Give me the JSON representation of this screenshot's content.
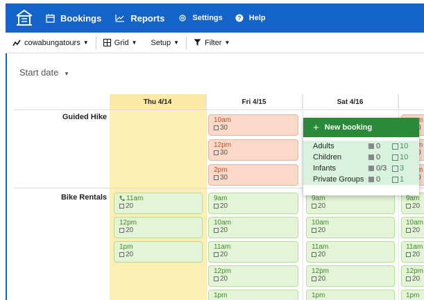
{
  "nav": {
    "bookings": "Bookings",
    "reports": "Reports",
    "settings": "Settings",
    "help": "Help"
  },
  "toolbar": {
    "account": "cowabungatours",
    "grid": "Grid",
    "setup": "Setup",
    "filter": "Filter"
  },
  "start_date": "Start date",
  "columns": [
    {
      "label": "Thu 4/14"
    },
    {
      "label": "Fri 4/15"
    },
    {
      "label": "Sat 4/16"
    }
  ],
  "rows": {
    "guided_hike": "Guided Hike",
    "bike_rentals": "Bike Rentals"
  },
  "slots": {
    "hike_fri": [
      {
        "time": "10am",
        "cap": "30"
      },
      {
        "time": "12pm",
        "cap": "30"
      },
      {
        "time": "2pm",
        "cap": "30"
      }
    ],
    "hike_sun": [
      {
        "time": "m",
        "cap": "0"
      },
      {
        "time": "m",
        "cap": "0"
      },
      {
        "time": "m",
        "cap": "0"
      }
    ],
    "bike_thu": [
      {
        "time": "11am",
        "cap": "20"
      },
      {
        "time": "12pm",
        "cap": "20"
      },
      {
        "time": "1pm",
        "cap": "20"
      }
    ],
    "bike_fri": [
      {
        "time": "9am",
        "cap": "20"
      },
      {
        "time": "10am",
        "cap": "20"
      },
      {
        "time": "11am",
        "cap": "20"
      },
      {
        "time": "12pm",
        "cap": "20"
      },
      {
        "time": "1pm",
        "cap": ""
      }
    ],
    "bike_sat": [
      {
        "time": "9am",
        "cap": "20"
      },
      {
        "time": "10am",
        "cap": "20"
      },
      {
        "time": "11am",
        "cap": "20"
      },
      {
        "time": "12pm",
        "cap": "20"
      },
      {
        "time": "1pm",
        "cap": ""
      }
    ],
    "bike_sun": [
      {
        "time": "9am",
        "cap": "20"
      },
      {
        "time": "10am",
        "cap": "20"
      },
      {
        "time": "11am",
        "cap": "20"
      },
      {
        "time": "12pm",
        "cap": "20"
      },
      {
        "time": "1pm",
        "cap": ""
      }
    ]
  },
  "popup": {
    "title": "New booking",
    "rows": [
      {
        "label": "Adults",
        "gray": "0",
        "green": "10"
      },
      {
        "label": "Children",
        "gray": "0",
        "green": "10"
      },
      {
        "label": "Infants",
        "gray": "0/3",
        "green": "3"
      },
      {
        "label": "Private Groups",
        "gray": "0",
        "green": "1"
      }
    ]
  },
  "colors": {
    "nav_bg": "#1463c8",
    "today_bg": "#fdefb3",
    "slot_orange": "#fbd9c8",
    "slot_green": "#e4f4d6",
    "popup_header": "#2a8a3a"
  }
}
